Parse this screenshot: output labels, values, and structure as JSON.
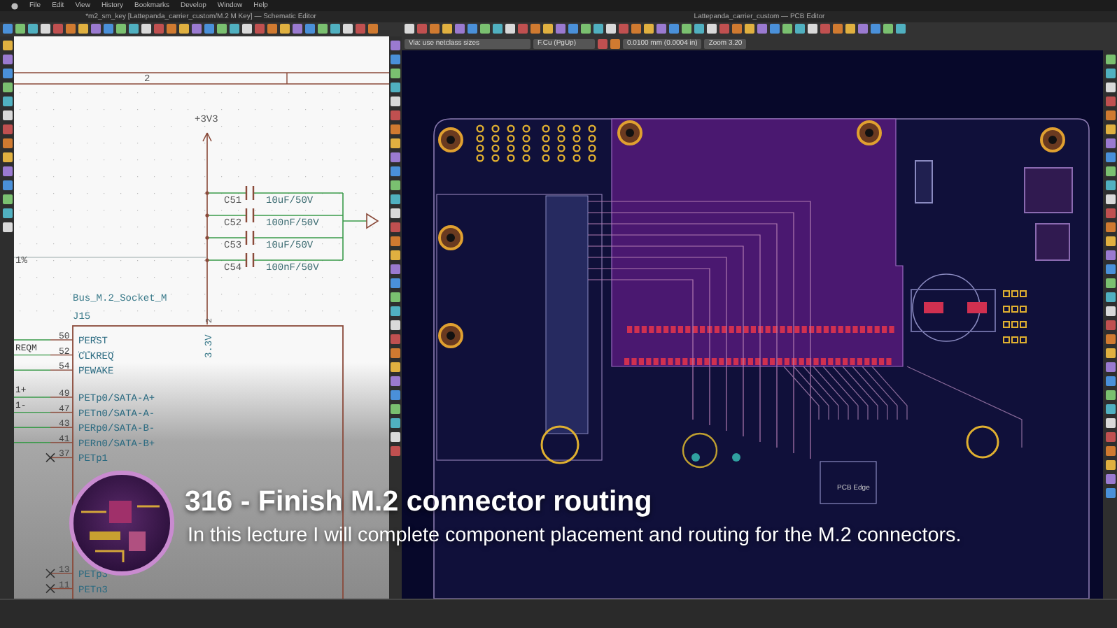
{
  "menu_bar": {
    "items": [
      "File",
      "Edit",
      "View",
      "History",
      "Bookmarks",
      "Develop",
      "Window",
      "Help"
    ]
  },
  "schematic_editor": {
    "title": "*m2_sm_key [Lattepanda_carrier_custom/M.2 M Key] — Schematic Editor",
    "sheet_zone": "2",
    "power_label": "+3V3",
    "capacitors": [
      {
        "ref": "C51",
        "value": "10uF/50V"
      },
      {
        "ref": "C52",
        "value": "100nF/50V"
      },
      {
        "ref": "C53",
        "value": "10uF/50V"
      },
      {
        "ref": "C54",
        "value": "100nF/50V"
      }
    ],
    "tolerance_label": "1%",
    "symbol_name": "Bus_M.2_Socket_M",
    "symbol_ref": "J15",
    "top_pin_number": "2",
    "top_pin_name": "3.3V",
    "pin_groups": [
      [
        {
          "number": "50",
          "name": "PERST",
          "active_low": true,
          "no_connect": false
        },
        {
          "number": "52",
          "name": "CLKREQ",
          "active_low": true,
          "no_connect": false,
          "net_label": "REQM"
        },
        {
          "number": "54",
          "name": "PEWAKE",
          "active_low": true,
          "no_connect": false
        }
      ],
      [
        {
          "number": "49",
          "name": "PETp0/SATA-A+",
          "active_low": false,
          "no_connect": false,
          "net_label": "1+"
        },
        {
          "number": "47",
          "name": "PETn0/SATA-A-",
          "active_low": false,
          "no_connect": false,
          "net_label": "1-"
        },
        {
          "number": "43",
          "name": "PERp0/SATA-B-",
          "active_low": false,
          "no_connect": false
        },
        {
          "number": "41",
          "name": "PERn0/SATA-B+",
          "active_low": false,
          "no_connect": false
        },
        {
          "number": "37",
          "name": "PETp1",
          "active_low": false,
          "no_connect": true
        }
      ],
      [
        {
          "number": "13",
          "name": "PETp3",
          "active_low": false,
          "no_connect": true
        },
        {
          "number": "11",
          "name": "PETn3",
          "active_low": false,
          "no_connect": true
        }
      ]
    ]
  },
  "pcb_editor": {
    "title": "Lattepanda_carrier_custom — PCB Editor",
    "via_size": "Via: use netclass sizes",
    "layer": "F.Cu (PgUp)",
    "grid": "0.0100 mm (0.0004 in)",
    "zoom": "Zoom 3.20",
    "edge_label": "PCB Edge"
  },
  "overlay": {
    "title": "316 - Finish M.2 connector routing",
    "subtitle": "In this lecture I will complete component placement and routing for the M.2 connectors."
  }
}
